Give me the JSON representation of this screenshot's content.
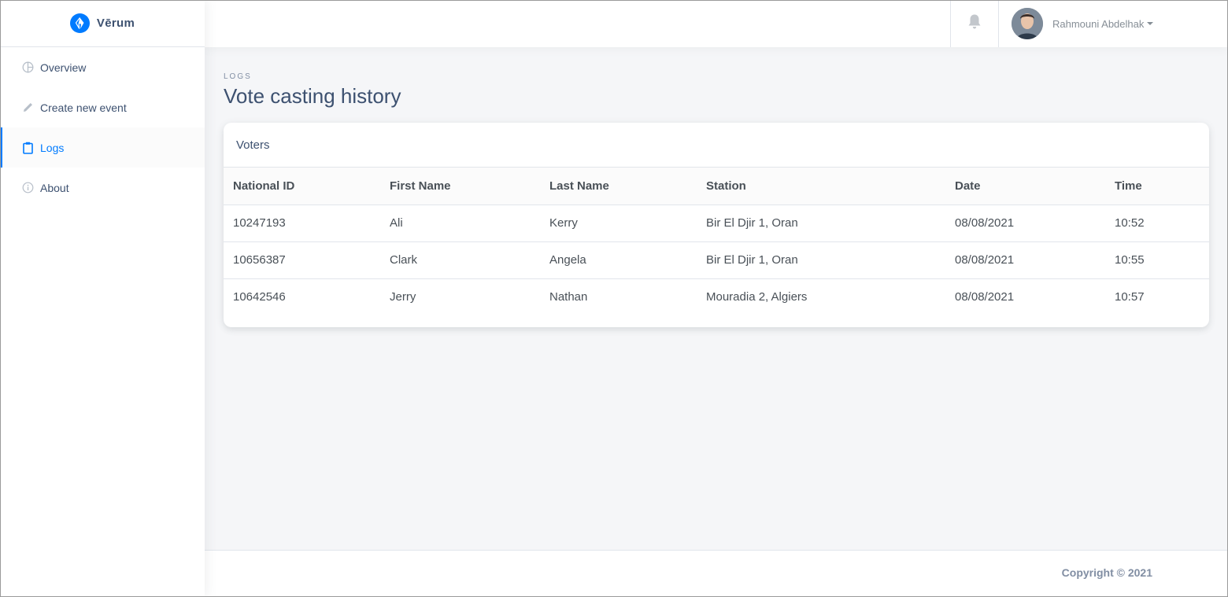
{
  "brand": {
    "name": "Vērum"
  },
  "sidebar": {
    "items": [
      {
        "label": "Overview",
        "icon": "pie-chart-icon",
        "active": false
      },
      {
        "label": "Create new event",
        "icon": "pencil-icon",
        "active": false
      },
      {
        "label": "Logs",
        "icon": "clipboard-icon",
        "active": true
      },
      {
        "label": "About",
        "icon": "info-circle-icon",
        "active": false
      }
    ]
  },
  "header": {
    "notification_icon": "bell-icon",
    "user_name": "Rahmouni Abdelhak"
  },
  "page": {
    "subtitle": "LOGS",
    "title": "Vote casting history"
  },
  "card": {
    "title": "Voters",
    "columns": [
      "National ID",
      "First Name",
      "Last Name",
      "Station",
      "Date",
      "Time"
    ],
    "rows": [
      [
        "10247193",
        "Ali",
        "Kerry",
        "Bir El Djir 1, Oran",
        "08/08/2021",
        "10:52"
      ],
      [
        "10656387",
        "Clark",
        "Angela",
        "Bir El Djir 1, Oran",
        "08/08/2021",
        "10:55"
      ],
      [
        "10642546",
        "Jerry",
        "Nathan",
        "Mouradia 2, Algiers",
        "08/08/2021",
        "10:57"
      ]
    ]
  },
  "footer": {
    "copyright": "Copyright © 2021"
  },
  "colors": {
    "accent": "#007bff",
    "text": "#3d5170",
    "muted": "#818ea3"
  }
}
